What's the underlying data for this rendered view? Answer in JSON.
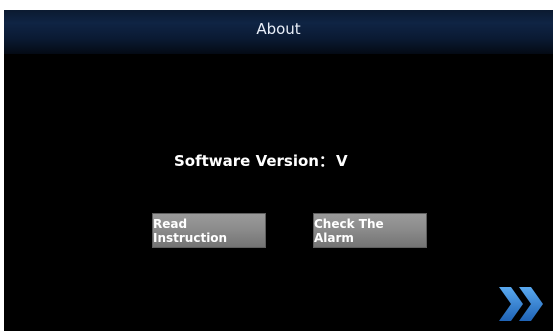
{
  "header": {
    "title": "About"
  },
  "main": {
    "version_label": "Software Version：",
    "version_value": "V"
  },
  "buttons": {
    "read_instruction": "Read Instruction",
    "check_alarm": "Check The Alarm"
  },
  "icons": {
    "next": "double-chevron-right-icon"
  },
  "colors": {
    "background": "#000000",
    "header": "#0f2444",
    "button": "#8a8a8a",
    "next_arrow": "#2f7fd1"
  }
}
